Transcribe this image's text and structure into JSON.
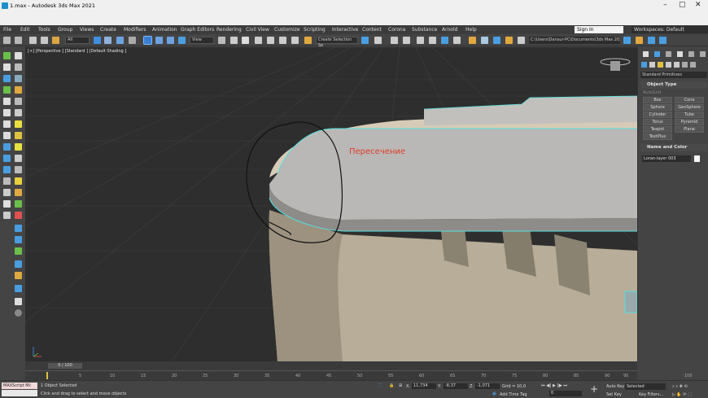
{
  "window": {
    "title": "1.max - Autodesk 3ds Max 2021",
    "minimize": "–",
    "restore": "▢",
    "close": "✕"
  },
  "menu": {
    "items": [
      "File",
      "Edit",
      "Tools",
      "Group",
      "Views",
      "Create",
      "Modifiers",
      "Animation",
      "Graph Editors",
      "Rendering",
      "Civil View",
      "Customize",
      "Scripting",
      "Interactive",
      "Content",
      "Corona",
      "Substance",
      "Arnold",
      "Help"
    ]
  },
  "account": {
    "sign_in": "Sign In",
    "workspace": "Workspaces: Default"
  },
  "toolbar": {
    "filter": "All",
    "view_dd": "View",
    "selection_set": "Create Selection Se",
    "project_path": "C:\\Users\\Dansur-PC\\Documents\\3ds Max 2021"
  },
  "viewport": {
    "label": "[+] [Perspective ] [Standard ] [Default Shading ]",
    "annotation": "Пересечение"
  },
  "command_panel": {
    "category": "Standard Primitives",
    "object_type_header": "Object Type",
    "autogrid": "AutoGrid",
    "buttons": [
      "Box",
      "Cone",
      "Sphere",
      "GeoSphere",
      "Cylinder",
      "Tube",
      "Torus",
      "Pyramid",
      "Teapot",
      "Plane",
      "TextPlus"
    ],
    "name_color_header": "Name and Color",
    "object_name": "Loran-layer 003",
    "swatch_color": "#f5f5f5"
  },
  "timeline": {
    "frame": "0 / 100",
    "ticks": [
      "5",
      "10",
      "15",
      "20",
      "25",
      "30",
      "35",
      "40",
      "45",
      "50",
      "55",
      "60",
      "65",
      "70",
      "75",
      "80",
      "85",
      "90",
      "95",
      "100"
    ]
  },
  "status": {
    "maxscript": "MAXScript Mi:",
    "selected": "1 Object Selected",
    "hint": "Click and drag to select and move objects",
    "x_label": "X:",
    "x": "11,734",
    "y_label": "Y:",
    "y": "-8,37",
    "z_label": "Z:",
    "z": "-1,071",
    "grid": "Grid = 10,0",
    "add_time_tag": "Add Time Tag",
    "auto_key": "Auto Key",
    "set_key": "Set Key",
    "selected_dd": "Selected",
    "key_filters": "Key Filters...",
    "frame_field": "0"
  },
  "colors": {
    "accent": "#55e0e0",
    "annotation": "#e03a2a",
    "viewport_bg": "#2e2e2e",
    "object": "#c8bca6"
  }
}
